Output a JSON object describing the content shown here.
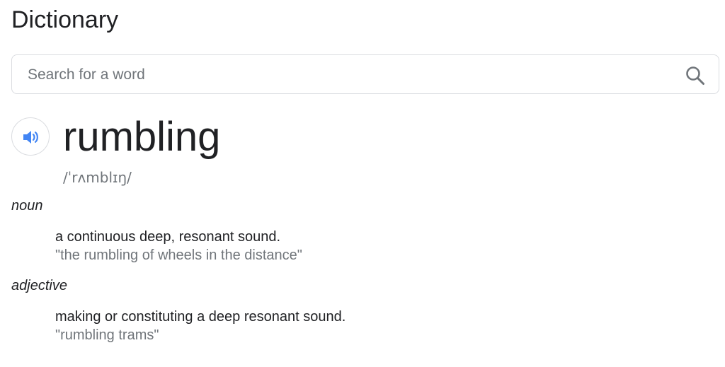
{
  "header": {
    "title": "Dictionary"
  },
  "search": {
    "placeholder": "Search for a word",
    "value": ""
  },
  "entry": {
    "word": "rumbling",
    "pronunciation": "/ˈrʌmblɪŋ/",
    "senses": [
      {
        "part_of_speech": "noun",
        "definition": "a continuous deep, resonant sound.",
        "example": "\"the rumbling of wheels in the distance\""
      },
      {
        "part_of_speech": "adjective",
        "definition": "making or constituting a deep resonant sound.",
        "example": "\"rumbling trams\""
      }
    ]
  },
  "colors": {
    "text_primary": "#202124",
    "text_secondary": "#70757a",
    "border": "#dadce0",
    "speaker_accent": "#4285f4"
  },
  "icons": {
    "search": "search-icon",
    "speaker": "speaker-icon"
  }
}
